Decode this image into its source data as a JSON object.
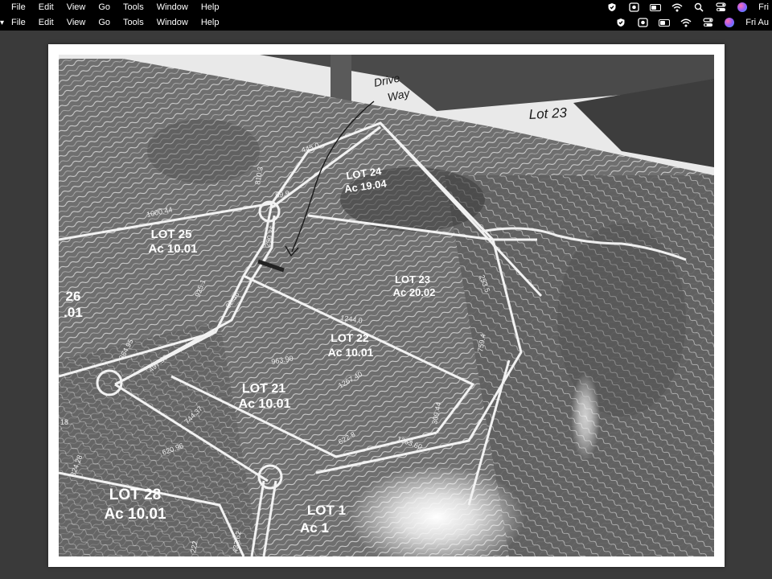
{
  "menubar_top": {
    "items": [
      "File",
      "Edit",
      "View",
      "Go",
      "Tools",
      "Window",
      "Help"
    ],
    "clock": "Fri"
  },
  "menubar_second": {
    "items": [
      "File",
      "Edit",
      "View",
      "Go",
      "Tools",
      "Window",
      "Help"
    ],
    "clock": "Fri Au"
  },
  "status_icons": [
    "shield-icon",
    "screen-record-icon",
    "battery-icon",
    "wifi-icon",
    "search-icon",
    "control-center-icon",
    "siri-icon"
  ],
  "map": {
    "lots": [
      {
        "lot": "LOT 24",
        "area": "Ac 19.04"
      },
      {
        "lot": "LOT 25",
        "area": "Ac 10.01"
      },
      {
        "lot": "LOT 23",
        "area": "Ac 20.02"
      },
      {
        "lot": "26",
        "area": ".01"
      },
      {
        "lot": "LOT 22",
        "area": "Ac 10.01"
      },
      {
        "lot": "LOT 21",
        "area": "Ac 10.01"
      },
      {
        "lot": "LOT 28",
        "area": "Ac 10.01"
      },
      {
        "lot": "LOT 1",
        "area": "Ac 1"
      }
    ],
    "dimensions": [
      "445.0",
      "99.9",
      "290.36",
      "1000.44",
      "810.3",
      "925.1",
      "82.36",
      "1244.0",
      "364.95",
      "497.50",
      "963.90",
      "1267.40",
      "744.37",
      "620.96",
      "622.8",
      "1263.60",
      "309.44",
      "432.62",
      "222",
      "324.28",
      "759.4",
      "253.5",
      "18"
    ],
    "handwritten": {
      "drive_way_line1": "Drive",
      "drive_way_line2": "Way",
      "lot_note": "Lot 23"
    }
  }
}
